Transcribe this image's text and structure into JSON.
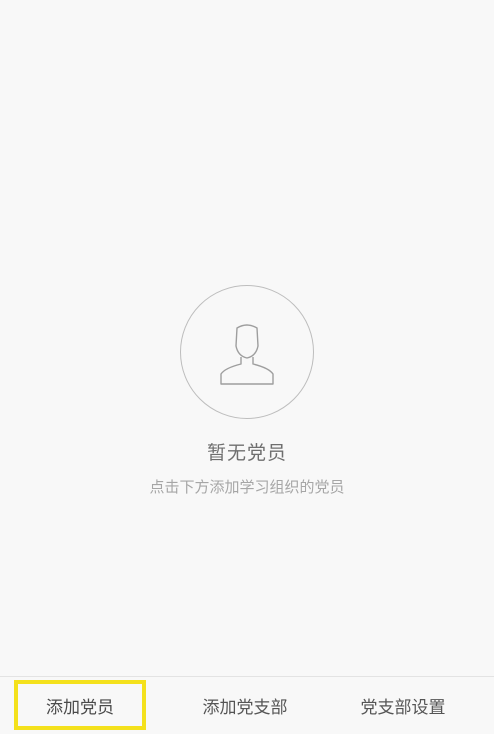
{
  "empty_state": {
    "icon": "person-icon",
    "title": "暂无党员",
    "hint": "点击下方添加学习组织的党员"
  },
  "tab_bar": {
    "tabs": [
      {
        "label": "添加党员",
        "highlighted": true
      },
      {
        "label": "添加党支部",
        "highlighted": false
      },
      {
        "label": "党支部设置",
        "highlighted": false
      }
    ]
  },
  "colors": {
    "background": "#f8f8f8",
    "highlight_border": "#f4e11c",
    "icon_stroke": "#bdbdbd"
  }
}
